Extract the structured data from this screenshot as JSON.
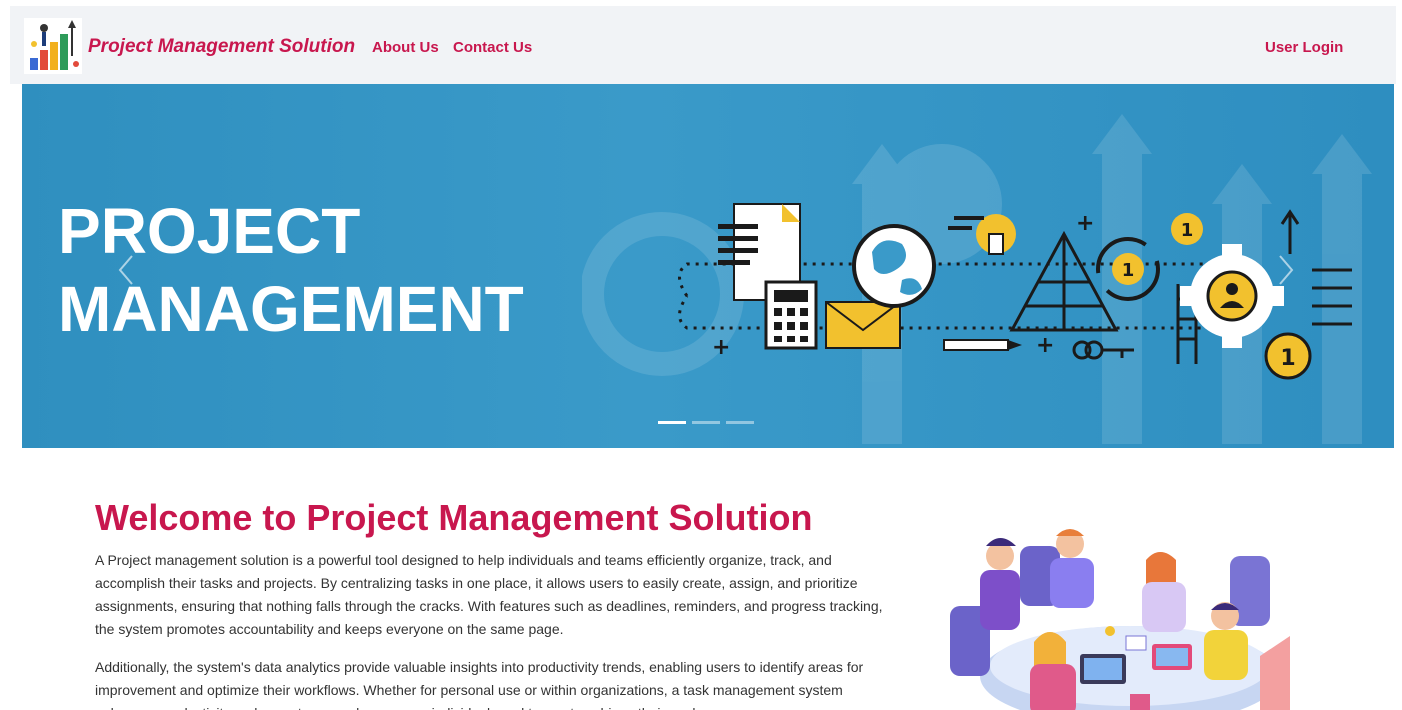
{
  "navbar": {
    "brand": "Project Management Solution",
    "links": [
      "About Us",
      "Contact Us"
    ],
    "login": "User Login"
  },
  "hero": {
    "title_line1": "PROJECT",
    "title_line2": "MANAGEMENT",
    "slides_total": 3,
    "active_slide": 1
  },
  "welcome": {
    "title": "Welcome to Project Management Solution",
    "paragraph1": "A Project management solution is a powerful tool designed to help individuals and teams efficiently organize, track, and accomplish their tasks and projects. By centralizing tasks in one place, it allows users to easily create, assign, and prioritize assignments, ensuring that nothing falls through the cracks. With features such as deadlines, reminders, and progress tracking, the system promotes accountability and keeps everyone on the same page.",
    "paragraph2": "Additionally, the system's data analytics provide valuable insights into productivity trends, enabling users to identify areas for improvement and optimize their workflows. Whether for personal use or within organizations, a task management system enhances productivity, reduces stress, and empowers individuals and teams to achieve their goals"
  },
  "colors": {
    "brand": "#c8174e",
    "hero_bg": "#3a9ac9",
    "navbar_bg": "#f1f3f6",
    "accent_yellow": "#f2c12e"
  },
  "icons": [
    "logo-icon",
    "chevron-left-icon",
    "chevron-right-icon",
    "document-icon",
    "calculator-icon",
    "envelope-icon",
    "globe-icon",
    "lightbulb-icon",
    "pyramid-icon",
    "refresh-icon",
    "gear-icon",
    "key-icon",
    "checklist-icon",
    "ladder-icon"
  ]
}
